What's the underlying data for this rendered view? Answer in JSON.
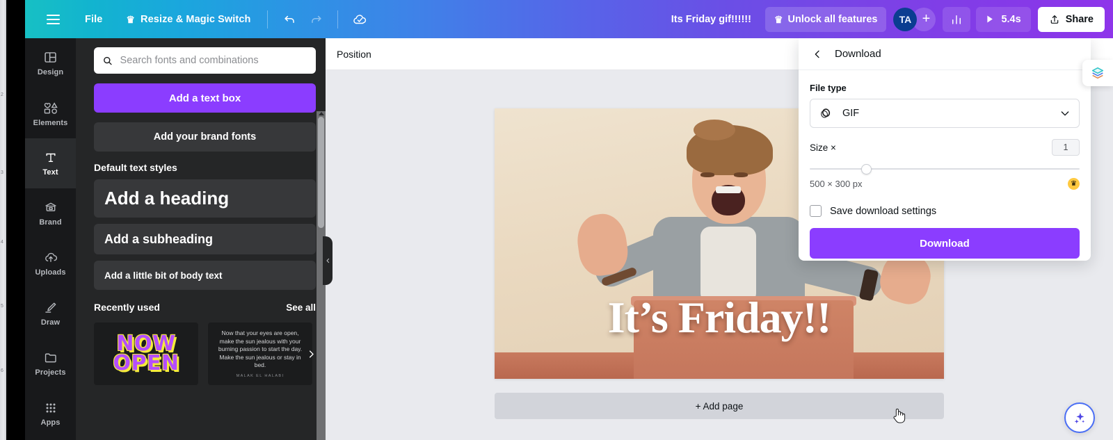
{
  "topbar": {
    "menu_icon": "hamburger-icon",
    "file_label": "File",
    "resize_label": "Resize & Magic Switch",
    "resize_crown": "♛",
    "undo_icon": "undo-icon",
    "redo_icon": "redo-icon",
    "saved_icon": "cloud-check-icon",
    "doc_title": "Its Friday gif!!!!!!",
    "unlock_label": "Unlock all features",
    "unlock_crown": "♛",
    "avatar_initials": "TA",
    "add_collab_label": "+",
    "insights_icon": "bar-chart-icon",
    "play_icon": "play-icon",
    "duration_label": "5.4s",
    "share_icon": "share-upload-icon",
    "share_label": "Share"
  },
  "rail": {
    "items": [
      {
        "label": "Design",
        "icon": "design-icon",
        "active": false
      },
      {
        "label": "Elements",
        "icon": "elements-icon",
        "active": false
      },
      {
        "label": "Text",
        "icon": "text-icon",
        "active": true
      },
      {
        "label": "Brand",
        "icon": "brand-icon",
        "active": false
      },
      {
        "label": "Uploads",
        "icon": "uploads-icon",
        "active": false
      },
      {
        "label": "Draw",
        "icon": "draw-icon",
        "active": false
      },
      {
        "label": "Projects",
        "icon": "projects-icon",
        "active": false
      },
      {
        "label": "Apps",
        "icon": "apps-icon",
        "active": false
      }
    ]
  },
  "text_panel": {
    "search_placeholder": "Search fonts and combinations",
    "search_value": "",
    "search_icon": "search-icon",
    "add_text_box_label": "Add a text box",
    "brand_fonts_label": "Add your brand fonts",
    "default_styles_title": "Default text styles",
    "styles": [
      {
        "label": "Add a heading"
      },
      {
        "label": "Add a subheading"
      },
      {
        "label": "Add a little bit of body text"
      }
    ],
    "recently_used_title": "Recently used",
    "see_all_label": "See all",
    "recent_items": [
      {
        "text": "NOW\nOPEN",
        "kind": "wordart"
      },
      {
        "text": "Now that your eyes are open, make the sun jealous with your burning passion to start the day. Make the sun jealous or stay in bed.",
        "author": "MALAK EL HALABI",
        "kind": "quote"
      }
    ],
    "next_arrow_icon": "chevron-right-icon"
  },
  "collapse_handle_icon": "chevron-left-icon",
  "main": {
    "position_label": "Position",
    "add_page_label": "+ Add page",
    "cursor_icon": "pointing-hand-cursor"
  },
  "canvas": {
    "overlay_text": "It’s Friday!!",
    "description": "Excited person waving behind an open cardboard box"
  },
  "download_panel": {
    "back_icon": "chevron-left-icon",
    "title": "Download",
    "file_type_label": "File type",
    "file_type_value": "GIF",
    "file_type_icon": "gif-icon",
    "chevron_icon": "chevron-down-icon",
    "size_label": "Size ×",
    "size_value": "1",
    "dimensions_text": "500 × 300 px",
    "crown_icon": "♛",
    "save_settings_label": "Save download settings",
    "save_settings_checked": false,
    "download_button_label": "Download"
  },
  "fabs": {
    "layers_icon": "layers-stack-icon",
    "magic_icon": "magic-sparkle-icon"
  },
  "os_strip": {
    "ticks": [
      "2",
      "3",
      "4",
      "5",
      "6"
    ]
  },
  "colors": {
    "accent_purple": "#8b3dff",
    "topbar_start": "#17c0c4",
    "topbar_end": "#8e35ea",
    "rail_bg": "#18191b",
    "panel_bg": "#252627",
    "avatar_bg": "#0b3d91",
    "crown_gold": "#ffc940"
  }
}
